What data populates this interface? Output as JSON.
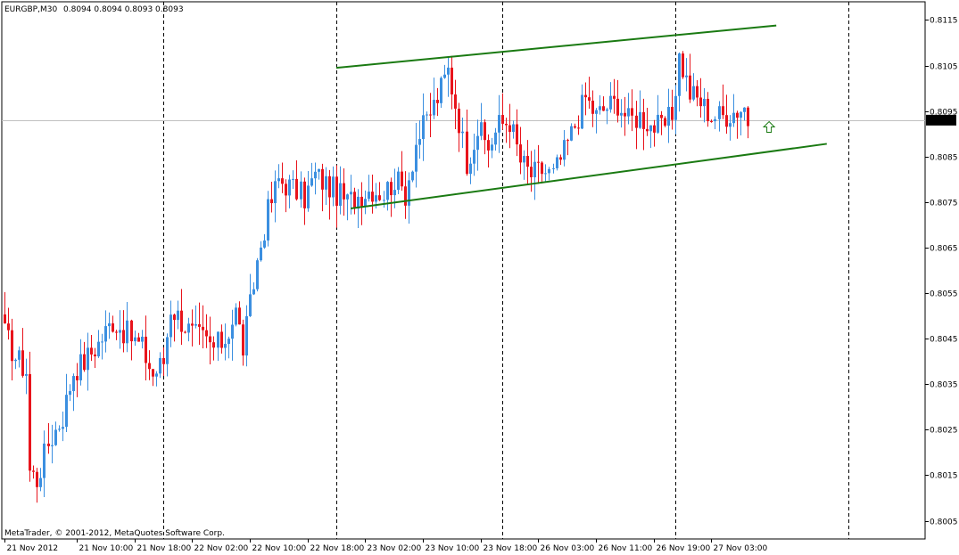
{
  "header": {
    "symbol_label": "EURGBP,M30",
    "ohlc": "0.8094 0.8094 0.8093 0.8093"
  },
  "footer": {
    "copyright": "MetaTrader, © 2001-2012, MetaQuotes Software Corp."
  },
  "colors": {
    "background": "#ffffff",
    "frame": "#000000",
    "bull_candle": "#3b8fe0",
    "bear_candle": "#e8141c",
    "trendline": "#1a7a12",
    "price_line": "#c0c0c0",
    "period_separator": "#000000",
    "arrow": "#1a7a12"
  },
  "chart_data": {
    "type": "candlestick",
    "symbol": "EURGBP",
    "timeframe": "M30",
    "y_axis": {
      "ticks": [
        "0.8115",
        "0.8105",
        "0.8095",
        "0.8085",
        "0.8075",
        "0.8065",
        "0.8055",
        "0.8045",
        "0.8035",
        "0.8025",
        "0.8015",
        "0.8005"
      ],
      "range": [
        0.8001,
        0.8119
      ]
    },
    "x_axis": {
      "ticks": [
        {
          "label": "21 Nov 2012",
          "index": 0
        },
        {
          "label": "21 Nov 10:00",
          "index": 20
        },
        {
          "label": "21 Nov 18:00",
          "index": 36
        },
        {
          "label": "22 Nov 02:00",
          "index": 52
        },
        {
          "label": "22 Nov 10:00",
          "index": 68
        },
        {
          "label": "22 Nov 18:00",
          "index": 84
        },
        {
          "label": "23 Nov 02:00",
          "index": 100
        },
        {
          "label": "23 Nov 10:00",
          "index": 116
        },
        {
          "label": "23 Nov 18:00",
          "index": 132
        },
        {
          "label": "26 Nov 03:00",
          "index": 148
        },
        {
          "label": "26 Nov 11:00",
          "index": 164
        },
        {
          "label": "26 Nov 19:00",
          "index": 180
        },
        {
          "label": "27 Nov 03:00",
          "index": 196
        }
      ],
      "bar_count": 256
    },
    "current_price": {
      "value": 0.8093,
      "label": "0.8093"
    },
    "period_separators": [
      44,
      92,
      138,
      186,
      234
    ],
    "trendlines": [
      {
        "from": {
          "index": 92,
          "price": 0.81045
        },
        "to": {
          "index": 214,
          "price": 0.81138
        }
      },
      {
        "from": {
          "index": 96,
          "price": 0.80736
        },
        "to": {
          "index": 228,
          "price": 0.80878
        }
      }
    ],
    "arrow_up": {
      "index": 212,
      "price": 0.80915
    },
    "anchors": [
      [
        0,
        0.8046
      ],
      [
        3,
        0.8041
      ],
      [
        6,
        0.8038
      ],
      [
        7,
        0.8016
      ],
      [
        9,
        0.8014
      ],
      [
        12,
        0.8022
      ],
      [
        16,
        0.8028
      ],
      [
        19,
        0.8038
      ],
      [
        22,
        0.804
      ],
      [
        26,
        0.8044
      ],
      [
        30,
        0.8049
      ],
      [
        34,
        0.8046
      ],
      [
        38,
        0.8043
      ],
      [
        41,
        0.8037
      ],
      [
        44,
        0.804
      ],
      [
        46,
        0.8052
      ],
      [
        49,
        0.8049
      ],
      [
        52,
        0.8046
      ],
      [
        55,
        0.8045
      ],
      [
        58,
        0.8043
      ],
      [
        61,
        0.8045
      ],
      [
        64,
        0.8051
      ],
      [
        66,
        0.8043
      ],
      [
        68,
        0.8052
      ],
      [
        70,
        0.8062
      ],
      [
        73,
        0.8073
      ],
      [
        76,
        0.808
      ],
      [
        80,
        0.8078
      ],
      [
        83,
        0.8076
      ],
      [
        86,
        0.8081
      ],
      [
        89,
        0.8079
      ],
      [
        92,
        0.8077
      ],
      [
        95,
        0.8075
      ],
      [
        99,
        0.8077
      ],
      [
        102,
        0.8078
      ],
      [
        105,
        0.8077
      ],
      [
        108,
        0.808
      ],
      [
        111,
        0.8077
      ],
      [
        114,
        0.8088
      ],
      [
        117,
        0.8093
      ],
      [
        120,
        0.8098
      ],
      [
        123,
        0.8104
      ],
      [
        126,
        0.8093
      ],
      [
        128,
        0.8084
      ],
      [
        131,
        0.8091
      ],
      [
        134,
        0.8087
      ],
      [
        137,
        0.8092
      ],
      [
        140,
        0.8093
      ],
      [
        143,
        0.8084
      ],
      [
        146,
        0.8081
      ],
      [
        149,
        0.8082
      ],
      [
        152,
        0.8081
      ],
      [
        155,
        0.8086
      ],
      [
        158,
        0.8092
      ],
      [
        161,
        0.8098
      ],
      [
        164,
        0.8094
      ],
      [
        167,
        0.8096
      ],
      [
        170,
        0.8097
      ],
      [
        173,
        0.8093
      ],
      [
        176,
        0.8094
      ],
      [
        179,
        0.8092
      ],
      [
        182,
        0.8091
      ],
      [
        185,
        0.8094
      ],
      [
        187,
        0.8107
      ],
      [
        190,
        0.8099
      ],
      [
        193,
        0.8097
      ],
      [
        196,
        0.8094
      ],
      [
        199,
        0.8094
      ],
      [
        202,
        0.8095
      ],
      [
        205,
        0.8096
      ],
      [
        206,
        0.8093
      ]
    ]
  }
}
